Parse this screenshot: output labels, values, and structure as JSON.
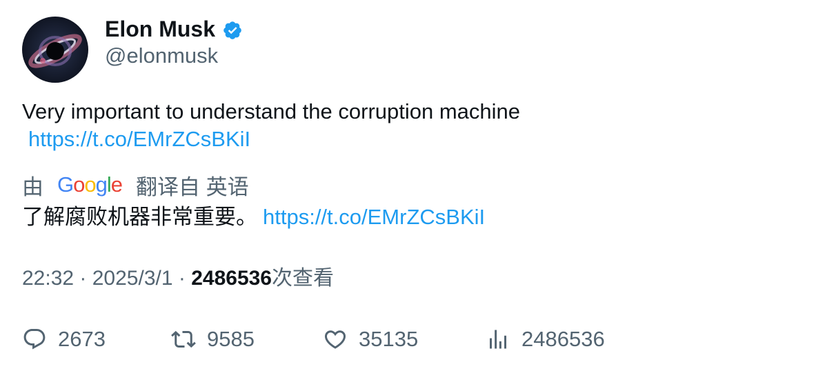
{
  "author": {
    "display_name": "Elon Musk",
    "handle": "@elonmusk",
    "verified_icon": "verified-badge-icon",
    "badge_color": "#1d9bf0"
  },
  "tweet": {
    "text": "Very important to understand the corruption machine",
    "link": "https://t.co/EMrZCsBKiI"
  },
  "translation": {
    "prefix": "由",
    "provider": "Google",
    "suffix": "翻译自 英语",
    "text": "了解腐败机器非常重要。",
    "link": "https://t.co/EMrZCsBKiI"
  },
  "meta": {
    "time": "22:32",
    "separator1": " · ",
    "date": "2025/3/1",
    "separator2": " · ",
    "views_count": "2486536",
    "views_label": "次查看"
  },
  "actions": {
    "replies": "2673",
    "retweets": "9585",
    "likes": "35135",
    "views": "2486536"
  },
  "colors": {
    "link": "#1d9bf0",
    "secondary_text": "#536471",
    "primary_text": "#0f1419"
  }
}
